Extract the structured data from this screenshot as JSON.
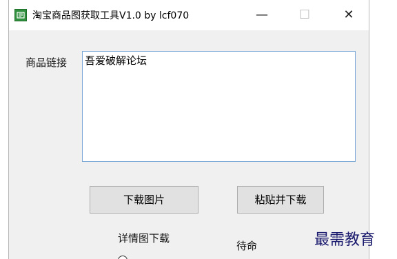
{
  "window": {
    "title": "淘宝商品图获取工具V1.0  by lcf070",
    "icon": "app-icon",
    "controls": {
      "minimize": "—",
      "maximize": "☐",
      "close": "✕"
    }
  },
  "form": {
    "link_label": "商品链接",
    "link_value": "吾爱破解论坛"
  },
  "buttons": {
    "download": "下载图片",
    "paste_download": "粘贴并下载"
  },
  "options": {
    "detail_label": "详情图下载"
  },
  "status": {
    "text": "待命"
  },
  "watermark": {
    "text": "最需教育"
  },
  "colors": {
    "window_bg": "#f0f0f0",
    "titlebar_bg": "#ffffff",
    "textbox_border": "#7aa7d6",
    "button_bg": "#e1e1e1",
    "icon_green": "#2f8f3e",
    "watermark": "#1a1a6e"
  }
}
